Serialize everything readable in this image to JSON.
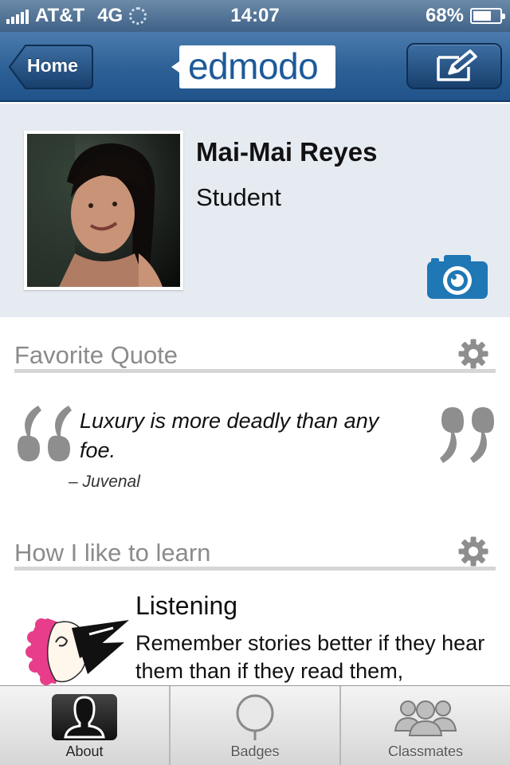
{
  "status_bar": {
    "carrier": "AT&T",
    "network": "4G",
    "time": "14:07",
    "battery_percent": "68%",
    "battery_level": 0.68
  },
  "nav": {
    "back_label": "Home",
    "logo_text": "edmodo",
    "compose_icon": "compose-icon"
  },
  "profile": {
    "name": "Mai-Mai Reyes",
    "role": "Student",
    "camera_icon": "camera-icon"
  },
  "favorite_quote": {
    "section_title": "Favorite Quote",
    "text": "Luxury is more deadly than any foe.",
    "author": "– Juvenal"
  },
  "learning": {
    "section_title": "How I like to learn",
    "style_title": "Listening",
    "style_description": "Remember stories better if they hear them than if they read them,"
  },
  "tabs": [
    {
      "label": "About",
      "icon": "person-icon",
      "active": true
    },
    {
      "label": "Badges",
      "icon": "badge-icon",
      "active": false
    },
    {
      "label": "Classmates",
      "icon": "classmates-icon",
      "active": false
    }
  ],
  "colors": {
    "nav_blue": "#2f6297",
    "logo_blue": "#1d5a99",
    "camera_blue": "#1f77b4",
    "profile_bg": "#e6ebf2"
  }
}
